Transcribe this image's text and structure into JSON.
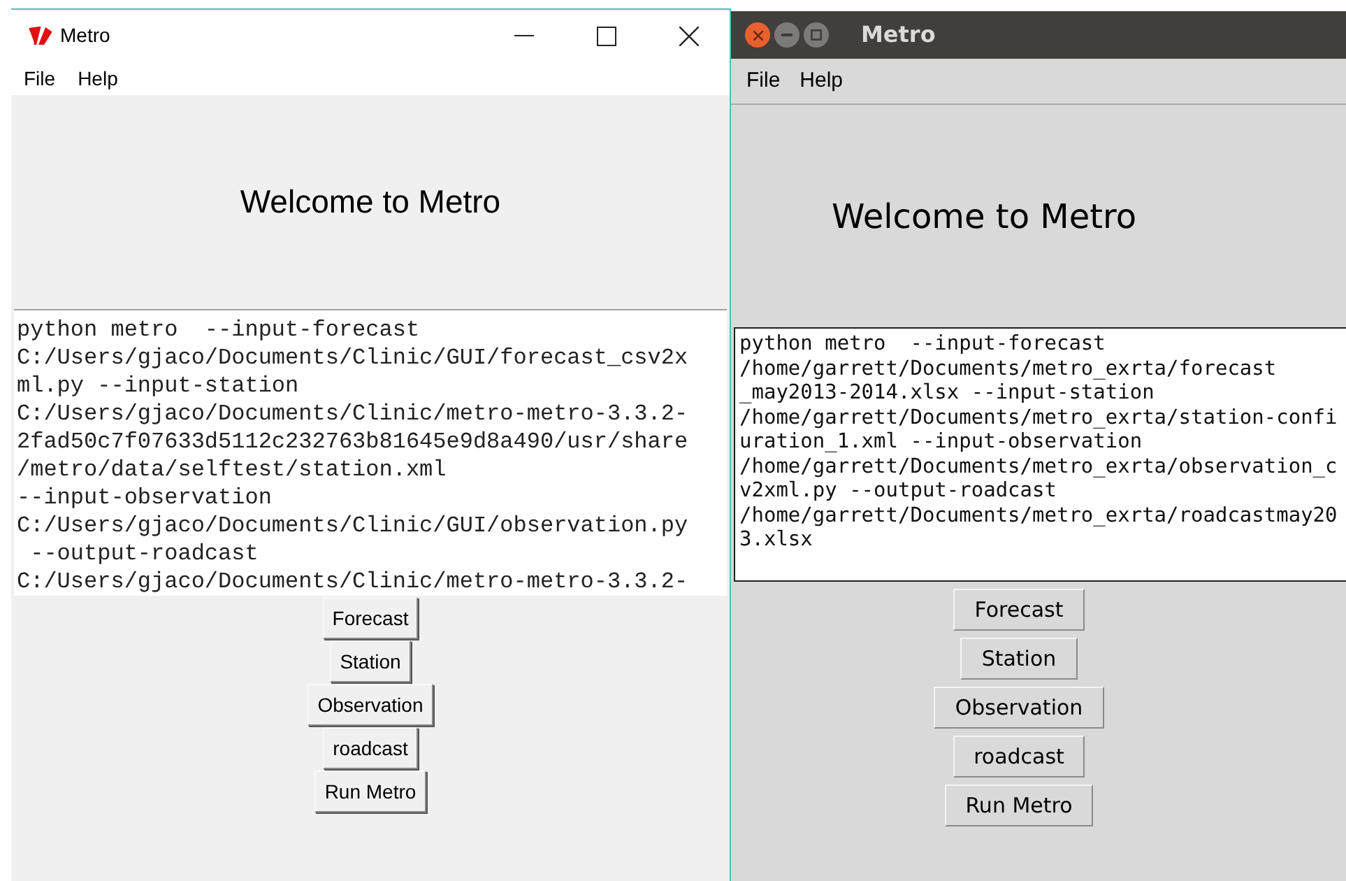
{
  "windows": [
    {
      "kind": "windows",
      "title": "Metro",
      "menu": [
        "File",
        "Help"
      ],
      "heading": "Welcome to Metro",
      "console_lines": [
        "python metro  --input-forecast",
        "C:/Users/gjaco/Documents/Clinic/GUI/forecast_csv2x",
        "ml.py --input-station",
        "C:/Users/gjaco/Documents/Clinic/metro-metro-3.3.2-",
        "2fad50c7f07633d5112c232763b81645e9d8a490/usr/share",
        "/metro/data/selftest/station.xml",
        "--input-observation",
        "C:/Users/gjaco/Documents/Clinic/GUI/observation.py",
        " --output-roadcast",
        "C:/Users/gjaco/Documents/Clinic/metro-metro-3.3.2-"
      ],
      "buttons": [
        "Forecast",
        "Station",
        "Observation",
        "roadcast",
        "Run Metro"
      ]
    },
    {
      "kind": "ubuntu",
      "title": "Metro",
      "menu": [
        "File",
        "Help"
      ],
      "heading": "Welcome to Metro",
      "console_lines": [
        "python metro  --input-forecast",
        "/home/garrett/Documents/metro_exrta/forecast",
        "_may2013-2014.xlsx --input-station",
        "/home/garrett/Documents/metro_exrta/station-confi",
        "uration_1.xml --input-observation",
        "/home/garrett/Documents/metro_exrta/observation_c",
        "v2xml.py --output-roadcast",
        "/home/garrett/Documents/metro_exrta/roadcastmay20",
        "3.xlsx"
      ],
      "buttons": [
        "Forecast",
        "Station",
        "Observation",
        "roadcast",
        "Run Metro"
      ]
    }
  ]
}
